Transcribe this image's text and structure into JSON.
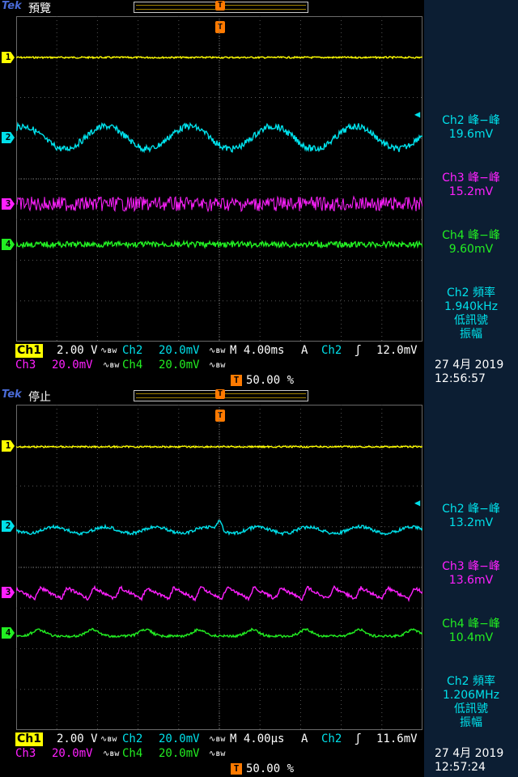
{
  "brand": "Tek",
  "colors": {
    "ch1": "#ffff00",
    "ch2": "#00e0ea",
    "ch3": "#ff20ff",
    "ch4": "#22ee22",
    "trigger": "#ff7a00",
    "meas_bg": "#0c1e33"
  },
  "icons": {
    "trigger_position": "trigger-position-icon",
    "ch2_level_arrow": "trigger-level-arrow-icon",
    "rising_edge": "rising-edge-icon",
    "bandwidth": "bandwidth-limit-icon"
  },
  "panels": [
    {
      "status": "預覽",
      "trigger_marker_text": "T",
      "channel_markers": [
        "1",
        "2",
        "3",
        "4"
      ],
      "measurements": [
        {
          "title": "Ch2 峰−峰",
          "value": "19.6mV"
        },
        {
          "title": "Ch3 峰−峰",
          "value": "15.2mV"
        },
        {
          "title": "Ch4 峰−峰",
          "value": "9.60mV"
        }
      ],
      "freq": {
        "title": "Ch2 頻率",
        "value": "1.940kHz",
        "note1": "低訊號",
        "note2": "振幅"
      },
      "settings": {
        "ch1_label": "Ch1",
        "ch1_scale": "2.00 V",
        "ch2_label": "Ch2",
        "ch2_scale": "20.0mV",
        "ch3_label": "Ch3",
        "ch3_scale": "20.0mV",
        "ch4_label": "Ch4",
        "ch4_scale": "20.0mV",
        "bw_symbol": "∿ʙw",
        "timebase": "M 4.00ms",
        "trigger_mode": "A",
        "trigger_source": "Ch2",
        "trigger_edge": "ʃ",
        "trigger_level": "12.0mV",
        "trigger_pos_label": "T",
        "trigger_pos": "50.00 %"
      },
      "date": "27 4月  2019",
      "time": "12:56:57"
    },
    {
      "status": "停止",
      "trigger_marker_text": "T",
      "channel_markers": [
        "1",
        "2",
        "3",
        "4"
      ],
      "measurements": [
        {
          "title": "Ch2 峰−峰",
          "value": "13.2mV"
        },
        {
          "title": "Ch3 峰−峰",
          "value": "13.6mV"
        },
        {
          "title": "Ch4 峰−峰",
          "value": "10.4mV"
        }
      ],
      "freq": {
        "title": "Ch2 頻率",
        "value": "1.206MHz",
        "note1": "低訊號",
        "note2": "振幅"
      },
      "settings": {
        "ch1_label": "Ch1",
        "ch1_scale": "2.00 V",
        "ch2_label": "Ch2",
        "ch2_scale": "20.0mV",
        "ch3_label": "Ch3",
        "ch3_scale": "20.0mV",
        "ch4_label": "Ch4",
        "ch4_scale": "20.0mV",
        "bw_symbol": "∿ʙw",
        "timebase": "M 4.00µs",
        "trigger_mode": "A",
        "trigger_source": "Ch2",
        "trigger_edge": "ʃ",
        "trigger_level": "11.6mV",
        "trigger_pos_label": "T",
        "trigger_pos": "50.00 %"
      },
      "date": "27 4月  2019",
      "time": "12:57:24"
    }
  ]
}
